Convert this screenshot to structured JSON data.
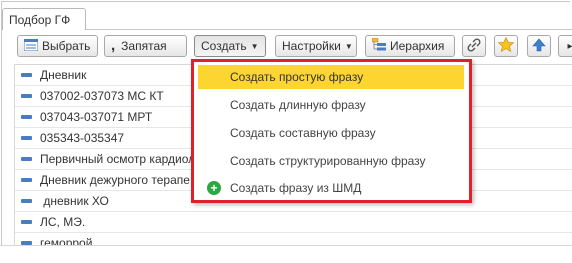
{
  "tab": {
    "label": "Подбор ГФ"
  },
  "toolbar": {
    "select_label": "Выбрать",
    "comma_label": "Запятая",
    "create_label": "Создать",
    "settings_label": "Настройки",
    "hierarchy_label": "Иерархия"
  },
  "list": {
    "rows": [
      "Дневник",
      "037002-037073 МС КТ",
      "037043-037071 МРТ",
      "035343-035347",
      "Первичный осмотр кардиол",
      "Дневник дежурного терапе",
      " дневник ХО",
      "ЛС, МЭ.",
      "геморрой"
    ]
  },
  "menu": {
    "items": [
      "Создать простую фразу",
      "Создать длинную фразу",
      "Создать составную фразу",
      "Создать структурированную фразу",
      "Создать фразу из ШМД"
    ]
  },
  "colors": {
    "highlight": "#fcd531",
    "popup_border": "#e0212a",
    "row_icon": "#4a7cc0",
    "plus_icon": "#2aa842"
  }
}
